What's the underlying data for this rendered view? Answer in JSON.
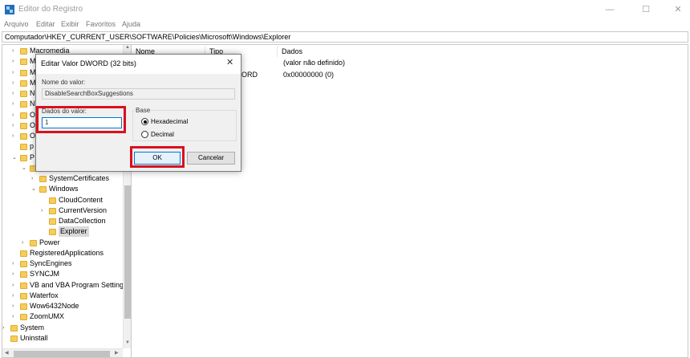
{
  "window": {
    "title": "Editor do Registro",
    "min_glyph": "—",
    "max_glyph": "☐",
    "close_glyph": "✕"
  },
  "menu": [
    "Arquivo",
    "Editar",
    "Exibir",
    "Favoritos",
    "Ajuda"
  ],
  "address": "Computador\\HKEY_CURRENT_USER\\SOFTWARE\\Policies\\Microsoft\\Windows\\Explorer",
  "tree": [
    {
      "label": "Macromedia",
      "depth": 0,
      "expander": "›"
    },
    {
      "label": "M",
      "depth": 0,
      "expander": "›"
    },
    {
      "label": "M",
      "depth": 0,
      "expander": "›"
    },
    {
      "label": "M",
      "depth": 0,
      "expander": "›"
    },
    {
      "label": "N",
      "depth": 0,
      "expander": "›"
    },
    {
      "label": "N",
      "depth": 0,
      "expander": "›"
    },
    {
      "label": "O",
      "depth": 0,
      "expander": "›"
    },
    {
      "label": "O",
      "depth": 0,
      "expander": "›"
    },
    {
      "label": "O",
      "depth": 0,
      "expander": "›"
    },
    {
      "label": "p",
      "depth": 0,
      "expander": ""
    },
    {
      "label": "P",
      "depth": 0,
      "expander": "⌄"
    },
    {
      "label": "",
      "depth": 1,
      "expander": "⌄"
    },
    {
      "label": "SystemCertificates",
      "depth": 2,
      "expander": "›"
    },
    {
      "label": "Windows",
      "depth": 2,
      "expander": "⌄"
    },
    {
      "label": "CloudContent",
      "depth": 3,
      "expander": ""
    },
    {
      "label": "CurrentVersion",
      "depth": 3,
      "expander": "›"
    },
    {
      "label": "DataCollection",
      "depth": 3,
      "expander": ""
    },
    {
      "label": "Explorer",
      "depth": 3,
      "expander": "",
      "selected": true
    },
    {
      "label": "Power",
      "depth": 1,
      "expander": "›"
    },
    {
      "label": "RegisteredApplications",
      "depth": 0,
      "expander": ""
    },
    {
      "label": "SyncEngines",
      "depth": 0,
      "expander": "›"
    },
    {
      "label": "SYNCJM",
      "depth": 0,
      "expander": "›"
    },
    {
      "label": "VB and VBA Program Settings",
      "depth": 0,
      "expander": "›"
    },
    {
      "label": "Waterfox",
      "depth": 0,
      "expander": "›"
    },
    {
      "label": "Wow6432Node",
      "depth": 0,
      "expander": "›"
    },
    {
      "label": "ZoomUMX",
      "depth": 0,
      "expander": "›"
    },
    {
      "label": "System",
      "depth": -1,
      "expander": "›"
    },
    {
      "label": "Uninstall",
      "depth": -1,
      "expander": ""
    }
  ],
  "values": {
    "columns": [
      "Nome",
      "Tipo",
      "Dados"
    ],
    "rows": [
      {
        "nome": "",
        "tipo": "",
        "dados": "(valor não definido)"
      },
      {
        "nome": "",
        "tipo": "ORD",
        "dados": "0x00000000 (0)"
      }
    ]
  },
  "dialog": {
    "title": "Editar Valor DWORD (32 bits)",
    "close_glyph": "✕",
    "name_label": "Nome do valor:",
    "name_value": "DisableSearchBoxSuggestions",
    "data_label": "Dados do valor:",
    "data_value": "1",
    "base_label": "Base",
    "hex_label": "Hexadecimal",
    "dec_label": "Decimal",
    "ok_label": "OK",
    "cancel_label": "Cancelar"
  },
  "colors": {
    "highlight": "#d9111d",
    "accent": "#0078d7",
    "folder": "#f5cd5c"
  }
}
